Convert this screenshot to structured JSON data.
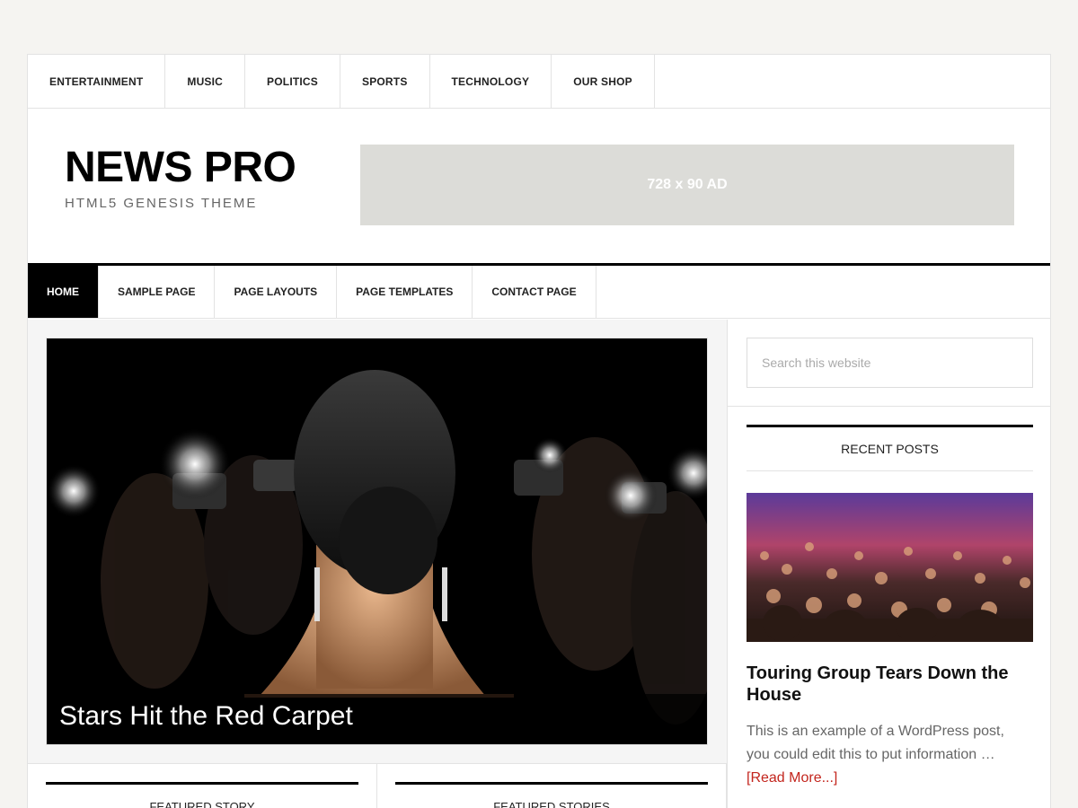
{
  "top_nav": [
    "ENTERTAINMENT",
    "MUSIC",
    "POLITICS",
    "SPORTS",
    "TECHNOLOGY",
    "OUR SHOP"
  ],
  "header": {
    "title": "NEWS PRO",
    "description": "HTML5 GENESIS THEME",
    "ad_label": "728 x 90 AD"
  },
  "main_nav": [
    "HOME",
    "SAMPLE PAGE",
    "PAGE LAYOUTS",
    "PAGE TEMPLATES",
    "CONTACT PAGE"
  ],
  "featured": {
    "title": "Stars Hit the Red Carpet"
  },
  "bottom_widgets": [
    "FEATURED STORY",
    "FEATURED STORIES"
  ],
  "sidebar": {
    "search_placeholder": "Search this website",
    "recent_posts_title": "RECENT POSTS",
    "post_title": "Touring Group Tears Down the House",
    "post_excerpt": "This is an example of a WordPress post, you could edit this to put information …",
    "read_more": "[Read More...]"
  },
  "colors": {
    "accent_link": "#c3251d",
    "nav_active_bg": "#000000",
    "page_bg": "#f5f4f1"
  }
}
